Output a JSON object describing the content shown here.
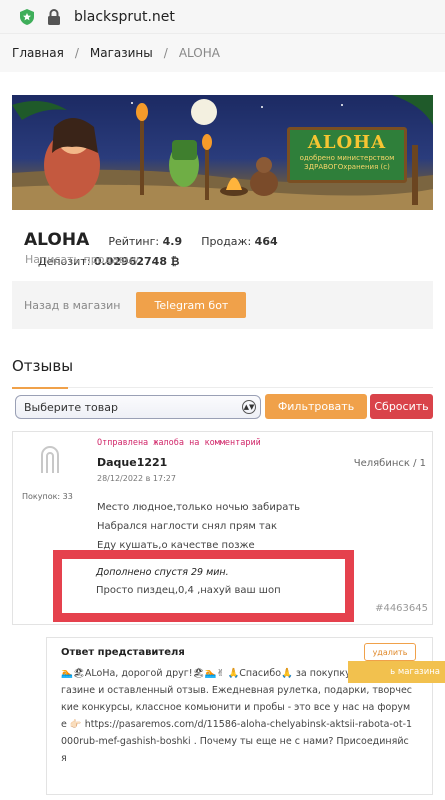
{
  "browser": {
    "url": "blacksprut.net"
  },
  "breadcrumb": {
    "items": [
      "Главная",
      "Магазины",
      "ALOHA"
    ],
    "separator": "/"
  },
  "banner": {
    "brand": "ALOHA",
    "tagline": "одобрено министерством ЗДРАВОГОхранения (с)"
  },
  "shop": {
    "name": "ALOHA",
    "rating_label": "Рейтинг:",
    "rating_value": "4.9",
    "sales_label": "Продаж:",
    "sales_value": "464",
    "deposit_label": "Депозит:",
    "deposit_value": "0.02962748",
    "deposit_currency": "₿",
    "write_seller": "Написать продавцу"
  },
  "actions": {
    "back": "Назад в магазин",
    "telegram": "Telegram бот"
  },
  "reviews": {
    "title": "Отзывы",
    "select_placeholder": "Выберите товар",
    "filter_button": "Фильтровать",
    "reset_button": "Сбросить"
  },
  "review": {
    "complaint": "Отправлена жалоба на комментарий",
    "username": "Daque1221",
    "date": "28/12/2022 в 17:27",
    "city": "Челябинск / 1",
    "purchases": "Покупок: 33",
    "lines": [
      "Место людное,только ночью забирать",
      "Набрался наглости снял прям так",
      "Еду кушать,о качестве позже"
    ],
    "added_title": "Дополнено спустя 29 мин.",
    "added_text": "Просто пиздец,0,4 ,нахуй ваш шоп",
    "id": "#4463645"
  },
  "reply": {
    "title": "Ответ представителя",
    "delete_button": "удалить",
    "text": "🏊🏖ALoHa, дорогой друг!🏖🏊✌ 🙏Спасибо🙏 за покупку в нашем магазине и оставленный отзыв. Ежедневная рулетка, подарки, творческие конкурсы, классное комьюнити и пробы - это все у нас на форуме 👉🏻 https://pasaremos.com/d/11586-aloha-chelyabinsk-aktsii-rabota-ot-1000rub-mef-gashish-boshki . Почему ты еще не с нами? Присоединяйся"
  },
  "floating": {
    "label": "ь магазина"
  },
  "colors": {
    "accent": "#f0a14a",
    "danger": "#d9434a",
    "highlight": "#e5414d",
    "complaint": "#d1286a"
  }
}
